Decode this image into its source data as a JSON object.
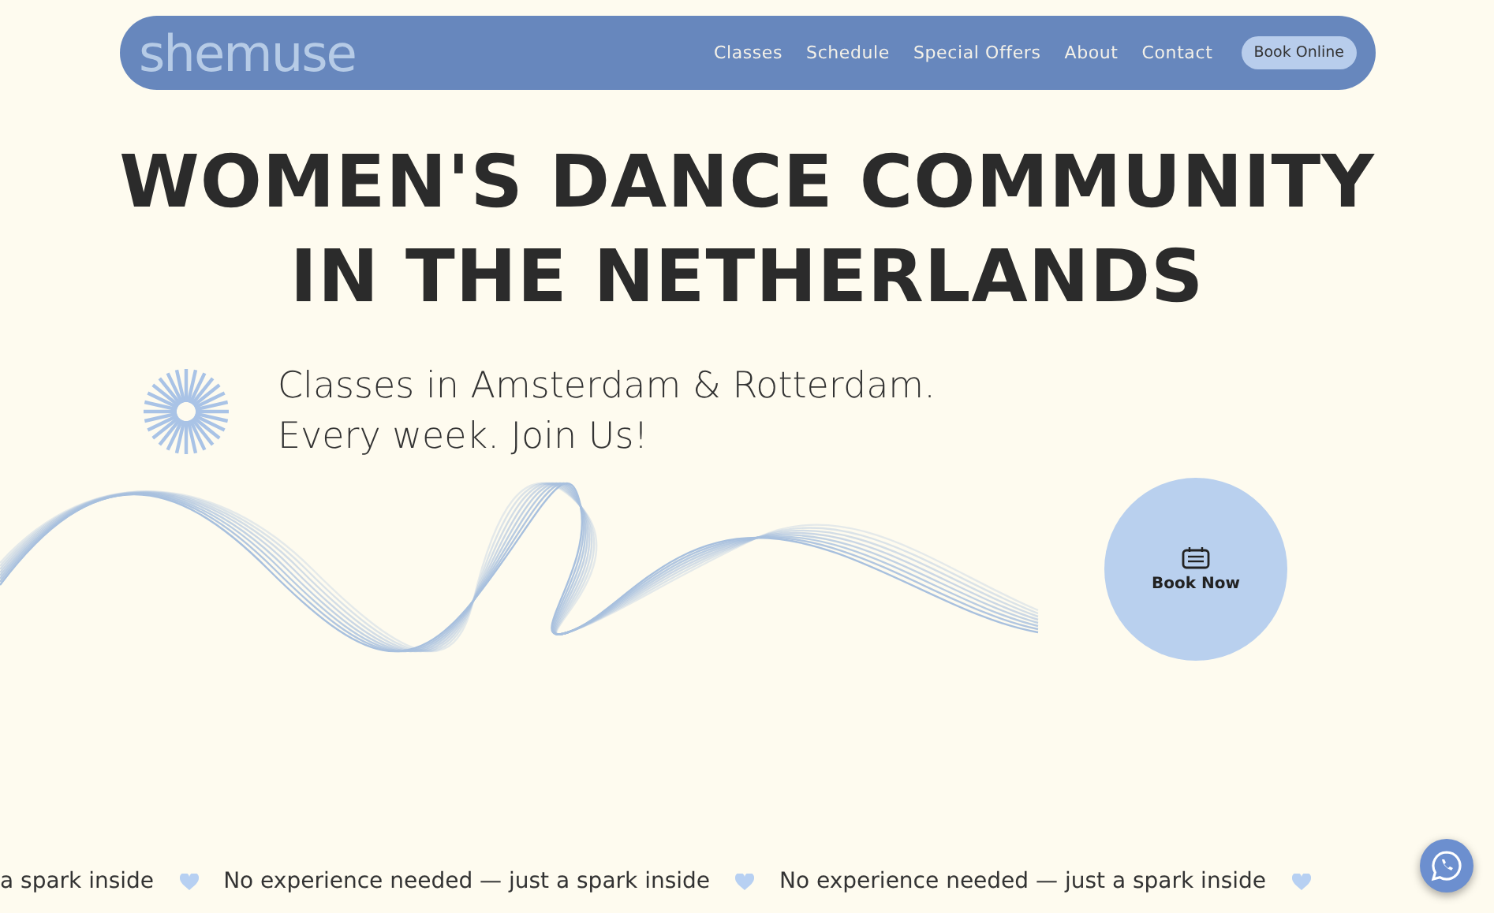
{
  "header": {
    "logo": "shemuse",
    "nav": [
      {
        "label": "Classes"
      },
      {
        "label": "Schedule"
      },
      {
        "label": "Special Offers"
      },
      {
        "label": "About"
      },
      {
        "label": "Contact"
      }
    ],
    "cta": "Book Online"
  },
  "hero": {
    "title_lines": [
      "WOMEN'S DANCE COMMUNITY",
      "IN THE NETHERLANDS"
    ],
    "subtitle_lines": [
      "Classes in Amsterdam & Rotterdam.",
      "Every week. Join Us!"
    ],
    "book_button": "Book Now"
  },
  "marquee": [
    "a spark inside",
    "No experience needed — just a spark inside",
    "No experience needed — just a spark inside"
  ]
}
